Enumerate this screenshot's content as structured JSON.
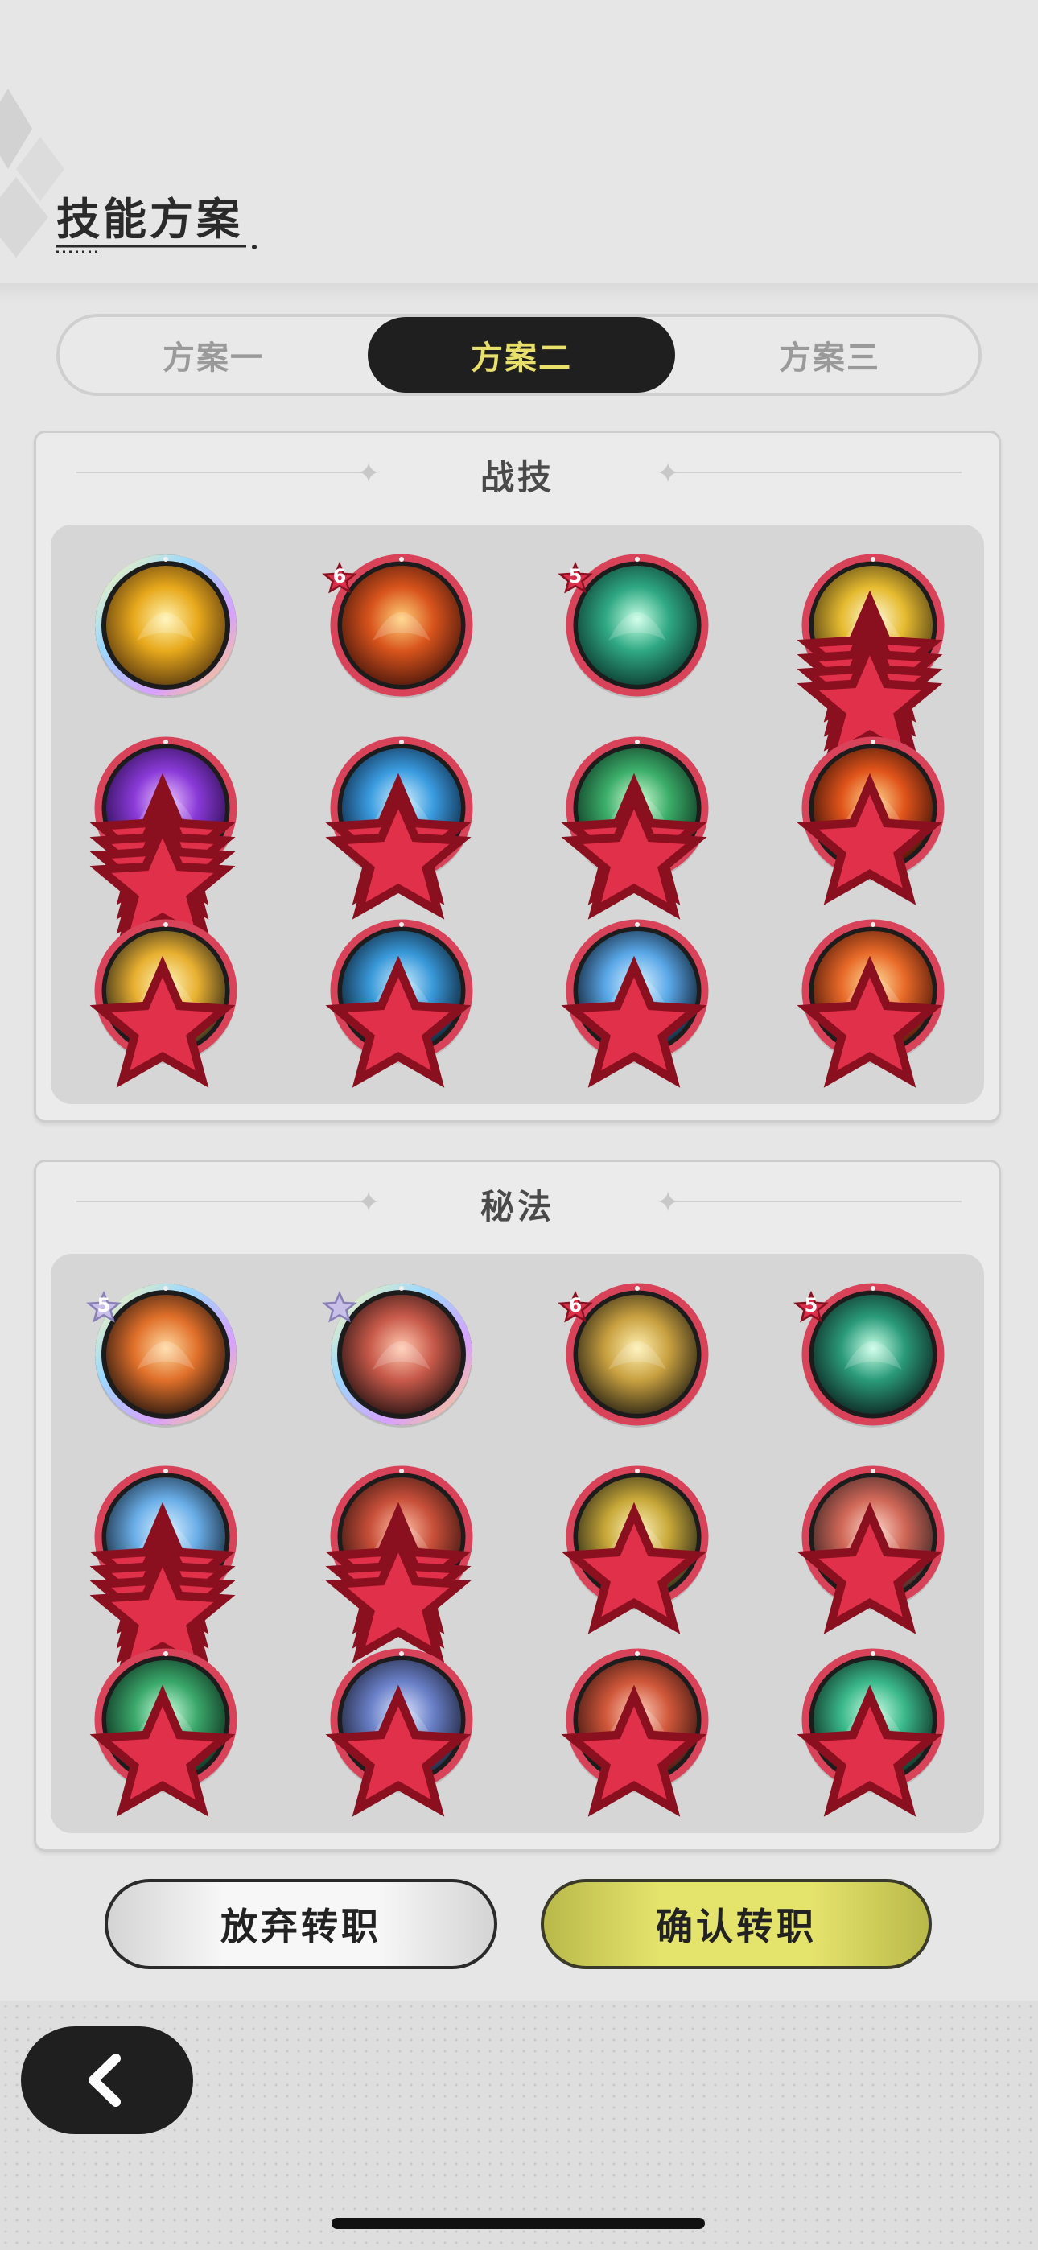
{
  "title": "技能方案",
  "tabs": [
    {
      "label": "方案一",
      "active": false
    },
    {
      "label": "方案二",
      "active": true
    },
    {
      "label": "方案三",
      "active": false
    }
  ],
  "panels": {
    "combat": {
      "title": "战技",
      "skills": [
        {
          "icon": "golden-burst-icon",
          "frame": "rainbow",
          "colors": [
            "#fff4b0",
            "#e8a91c",
            "#5a3a10"
          ],
          "badge": "",
          "stars": 0
        },
        {
          "icon": "lava-crack-icon",
          "frame": "red",
          "colors": [
            "#ffd07a",
            "#d8541c",
            "#4a160c"
          ],
          "badge": "6",
          "stars": 0
        },
        {
          "icon": "teal-vortex-icon",
          "frame": "red",
          "colors": [
            "#c8ffe6",
            "#2fa882",
            "#0c3a30"
          ],
          "badge": "5",
          "stars": 0
        },
        {
          "icon": "golden-sunburst-icon",
          "frame": "red",
          "colors": [
            "#fffbe0",
            "#e6bb30",
            "#4a3a12"
          ],
          "badge": "",
          "stars": 4
        },
        {
          "icon": "purple-rune-icon",
          "frame": "red",
          "colors": [
            "#f0c8ff",
            "#8a3ad8",
            "#2a0c4a"
          ],
          "badge": "",
          "stars": 4
        },
        {
          "icon": "ocean-wave-icon",
          "frame": "red",
          "colors": [
            "#d8f4ff",
            "#3a9ce0",
            "#0c2440"
          ],
          "badge": "",
          "stars": 2
        },
        {
          "icon": "green-orbit-icon",
          "frame": "red",
          "colors": [
            "#d8ffd8",
            "#3cae6a",
            "#0c3420"
          ],
          "badge": "",
          "stars": 2
        },
        {
          "icon": "fire-pentagram-icon",
          "frame": "red",
          "colors": [
            "#ffd890",
            "#e0541a",
            "#3a1008"
          ],
          "badge": "",
          "stars": 1
        },
        {
          "icon": "lightning-strike-icon",
          "frame": "red",
          "colors": [
            "#fff6c0",
            "#e8b030",
            "#2a2418"
          ],
          "badge": "",
          "stars": 1
        },
        {
          "icon": "blue-flame-icon",
          "frame": "red",
          "colors": [
            "#d0f0ff",
            "#3898d8",
            "#0c1c2c"
          ],
          "badge": "",
          "stars": 1
        },
        {
          "icon": "ice-shard-icon",
          "frame": "red",
          "colors": [
            "#e0f4ff",
            "#5aa8e8",
            "#0c1828"
          ],
          "badge": "",
          "stars": 1
        },
        {
          "icon": "fireball-icon",
          "frame": "red",
          "colors": [
            "#ffe0a0",
            "#e86a28",
            "#4a1408"
          ],
          "badge": "",
          "stars": 1
        }
      ]
    },
    "arcane": {
      "title": "秘法",
      "skills": [
        {
          "icon": "fire-swirl-icon",
          "frame": "rainbow",
          "colors": [
            "#ffd8a0",
            "#e0702a",
            "#2a1810"
          ],
          "badge": "5",
          "badge_style": "silver",
          "stars": 0
        },
        {
          "icon": "heal-figure-icon",
          "frame": "rainbow",
          "colors": [
            "#ffc8b0",
            "#c85a4a",
            "#2a1414"
          ],
          "badge": "",
          "badge_style": "silver-star",
          "stars": 0
        },
        {
          "icon": "golden-shield-icon",
          "frame": "red",
          "colors": [
            "#fff0b0",
            "#c8a040",
            "#2a2414"
          ],
          "badge": "6",
          "stars": 0
        },
        {
          "icon": "emerald-spikes-icon",
          "frame": "red",
          "colors": [
            "#c8ffe8",
            "#2a9a78",
            "#0c2420"
          ],
          "badge": "5",
          "stars": 0
        },
        {
          "icon": "ice-crystal-icon",
          "frame": "red",
          "colors": [
            "#e0f4ff",
            "#6aaee8",
            "#142434"
          ],
          "badge": "",
          "stars": 4
        },
        {
          "icon": "demon-face-icon",
          "frame": "red",
          "colors": [
            "#ffc0a8",
            "#c8503a",
            "#3a1410"
          ],
          "badge": "",
          "stars": 3
        },
        {
          "icon": "power-up-arrow-icon",
          "frame": "red",
          "colors": [
            "#fff4c0",
            "#c8a838",
            "#2a2818"
          ],
          "badge": "",
          "stars": 1
        },
        {
          "icon": "red-swirl-icon",
          "frame": "red",
          "colors": [
            "#ffd8cc",
            "#d06858",
            "#3a2424"
          ],
          "badge": "",
          "stars": 1
        },
        {
          "icon": "green-heart-icon",
          "frame": "red",
          "colors": [
            "#d0ffe0",
            "#3aa86a",
            "#0c2a1c"
          ],
          "badge": "",
          "stars": 1
        },
        {
          "icon": "blue-orb-icon",
          "frame": "red",
          "colors": [
            "#e0e8ff",
            "#6a80c8",
            "#1c2034"
          ],
          "badge": "",
          "stars": 1
        },
        {
          "icon": "red-figure-icon",
          "frame": "red",
          "colors": [
            "#ffd0c0",
            "#d0583a",
            "#3a1410"
          ],
          "badge": "",
          "stars": 1
        },
        {
          "icon": "green-figure-icon",
          "frame": "red",
          "colors": [
            "#d0ffe8",
            "#3ab88a",
            "#0c2a20"
          ],
          "badge": "",
          "stars": 1
        }
      ]
    }
  },
  "buttons": {
    "abandon": "放弃转职",
    "confirm": "确认转职"
  }
}
